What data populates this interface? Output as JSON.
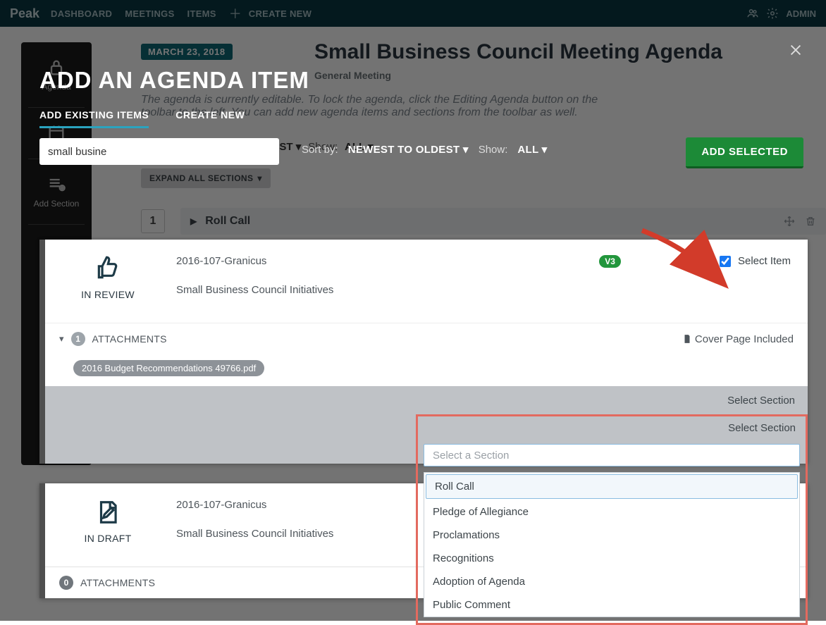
{
  "topbar": {
    "brand": "Peak",
    "nav": [
      "DASHBOARD",
      "MEETINGS",
      "ITEMS",
      "CREATE NEW"
    ],
    "admin": "ADMIN"
  },
  "sidebar": {
    "items": [
      {
        "label": "Agenda"
      },
      {
        "label": ""
      },
      {
        "label": "Add Section"
      },
      {
        "label": ""
      }
    ]
  },
  "page": {
    "date": "MARCH 23, 2018",
    "title": "Small Business Council Meeting Agenda",
    "subtitle": "General Meeting",
    "note": "The agenda is currently editable. To lock the agenda, click the Editing Agenda button on the toolbar to the left. You can add new agenda items and sections from the toolbar as well.",
    "sort_label": "Sort by:",
    "sort_value": "NEWEST TO OLDEST",
    "show_label": "Show:",
    "show_value": "ALL",
    "expand": "EXPAND ALL SECTIONS",
    "rollcall_num": "1",
    "rollcall": "Roll Call"
  },
  "modal": {
    "title": "ADD AN AGENDA ITEM",
    "tabs": {
      "existing": "ADD EXISTING ITEMS",
      "create": "CREATE NEW"
    },
    "search_value": "small busine",
    "sort_label": "Sort by:",
    "sort_value": "NEWEST TO OLDEST",
    "show_label": "Show:",
    "show_value": "ALL",
    "add_selected": "ADD SELECTED"
  },
  "cards": [
    {
      "status": "IN REVIEW",
      "item_id": "2016-107-Granicus",
      "item_title": "Small Business Council Initiatives",
      "version": "V3",
      "select_label": "Select Item",
      "attach_count": "1",
      "attach_label": "ATTACHMENTS",
      "cover_page": "Cover Page Included",
      "attachment_name": "2016 Budget Recommendations 49766.pdf",
      "select_section_label": "Select Section"
    },
    {
      "status": "IN DRAFT",
      "item_id": "2016-107-Granicus",
      "item_title": "Small Business Council Initiatives",
      "attach_count": "0",
      "attach_label": "ATTACHMENTS"
    }
  ],
  "section_dropdown": {
    "label": "Select Section",
    "placeholder": "Select a Section",
    "options": [
      "Roll Call",
      "Pledge of Allegiance",
      "Proclamations",
      "Recognitions",
      "Adoption of Agenda",
      "Public Comment"
    ]
  }
}
